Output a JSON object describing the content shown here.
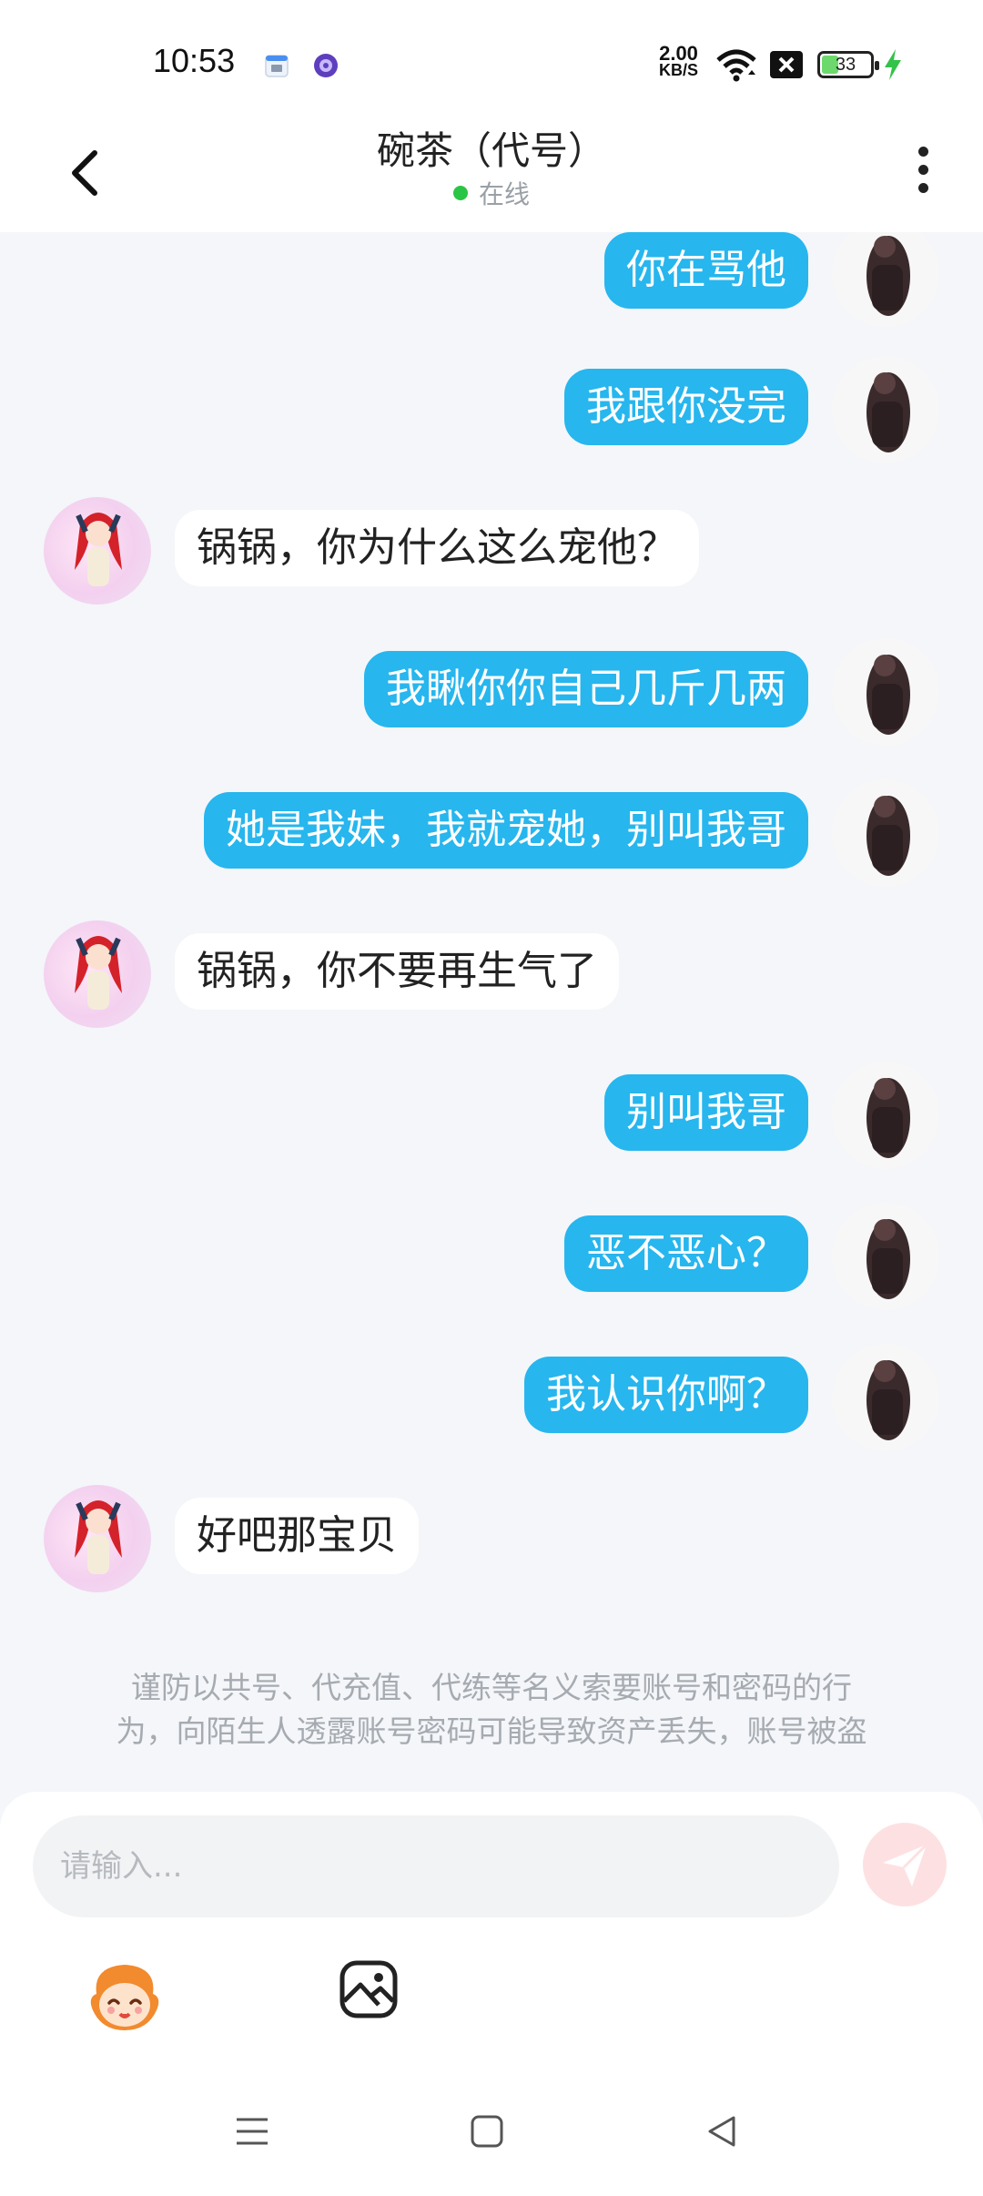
{
  "status_bar": {
    "time": "10:53",
    "net_speed_value": "2.00",
    "net_speed_unit": "KB/S",
    "battery_level": "33",
    "battery_fraction": 0.33
  },
  "header": {
    "title": "碗茶（代号）",
    "status_text": "在线"
  },
  "messages": [
    {
      "side": "me",
      "text": "你在骂他"
    },
    {
      "side": "me",
      "text": "我跟你没完"
    },
    {
      "side": "them",
      "text": "锅锅，你为什么这么宠他？"
    },
    {
      "side": "me",
      "text": "我瞅你你自己几斤几两"
    },
    {
      "side": "me",
      "text": "她是我妹，我就宠她，别叫我哥"
    },
    {
      "side": "them",
      "text": "锅锅，你不要再生气了"
    },
    {
      "side": "me",
      "text": "别叫我哥"
    },
    {
      "side": "me",
      "text": "恶不恶心？"
    },
    {
      "side": "me",
      "text": "我认识你啊？"
    },
    {
      "side": "them",
      "text": "好吧那宝贝"
    }
  ],
  "warning": {
    "line1": "谨防以共号、代充值、代练等名义索要账号和密码的行",
    "line2": "为，向陌生人透露账号密码可能导致资产丢失，账号被盗"
  },
  "input": {
    "placeholder": "请输入..."
  },
  "icons": {
    "back": "chevron-left-icon",
    "more": "more-vertical-icon",
    "send": "send-icon",
    "emoji": "emoji-mascot-icon",
    "image": "image-icon",
    "nav_menu": "menu-icon",
    "nav_home": "home-square-icon",
    "nav_back": "back-triangle-icon"
  },
  "colors": {
    "my_bubble": "#27b6ee",
    "their_bubble": "#ffffff",
    "online_dot": "#2bc545",
    "send_button_bg": "#fde1e2"
  }
}
